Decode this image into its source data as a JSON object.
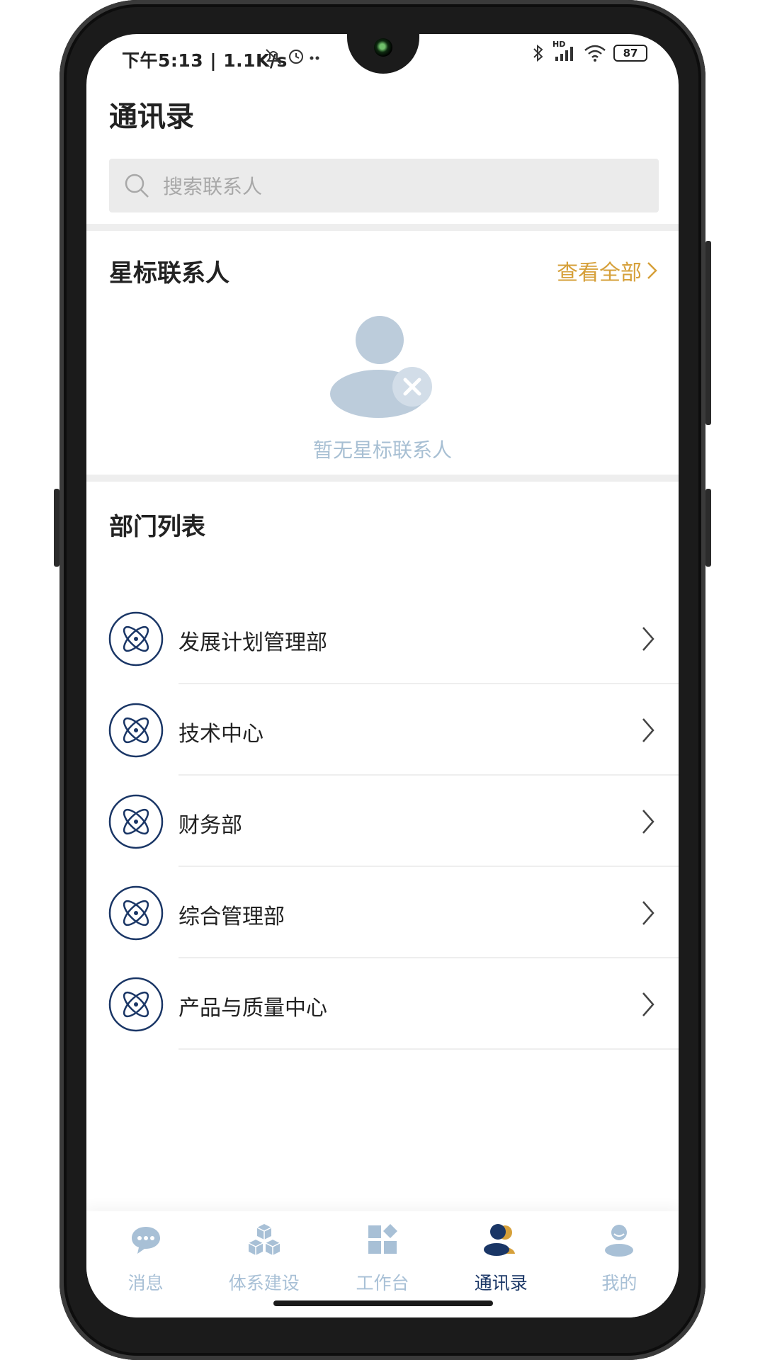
{
  "status_bar": {
    "time": "下午5:13 | 1.1K/s",
    "battery": "87",
    "network_label": "HD"
  },
  "page": {
    "title": "通讯录"
  },
  "search": {
    "placeholder": "搜索联系人"
  },
  "starred": {
    "title": "星标联系人",
    "view_all": "查看全部",
    "empty_text": "暂无星标联系人"
  },
  "departments": {
    "title": "部门列表",
    "items": [
      {
        "label": "发展计划管理部"
      },
      {
        "label": "技术中心"
      },
      {
        "label": "财务部"
      },
      {
        "label": "综合管理部"
      },
      {
        "label": "产品与质量中心"
      }
    ]
  },
  "tabbar": {
    "items": [
      {
        "label": "消息",
        "icon": "chat-bubble-icon",
        "active": false
      },
      {
        "label": "体系建设",
        "icon": "cubes-icon",
        "active": false
      },
      {
        "label": "工作台",
        "icon": "grid-icon",
        "active": false
      },
      {
        "label": "通讯录",
        "icon": "contacts-icon",
        "active": true
      },
      {
        "label": "我的",
        "icon": "person-icon",
        "active": false
      }
    ]
  },
  "colors": {
    "accent_gold": "#d6a03a",
    "nav_active": "#1a3666",
    "nav_inactive": "#a8c0d6",
    "dept_icon": "#1a3666"
  }
}
